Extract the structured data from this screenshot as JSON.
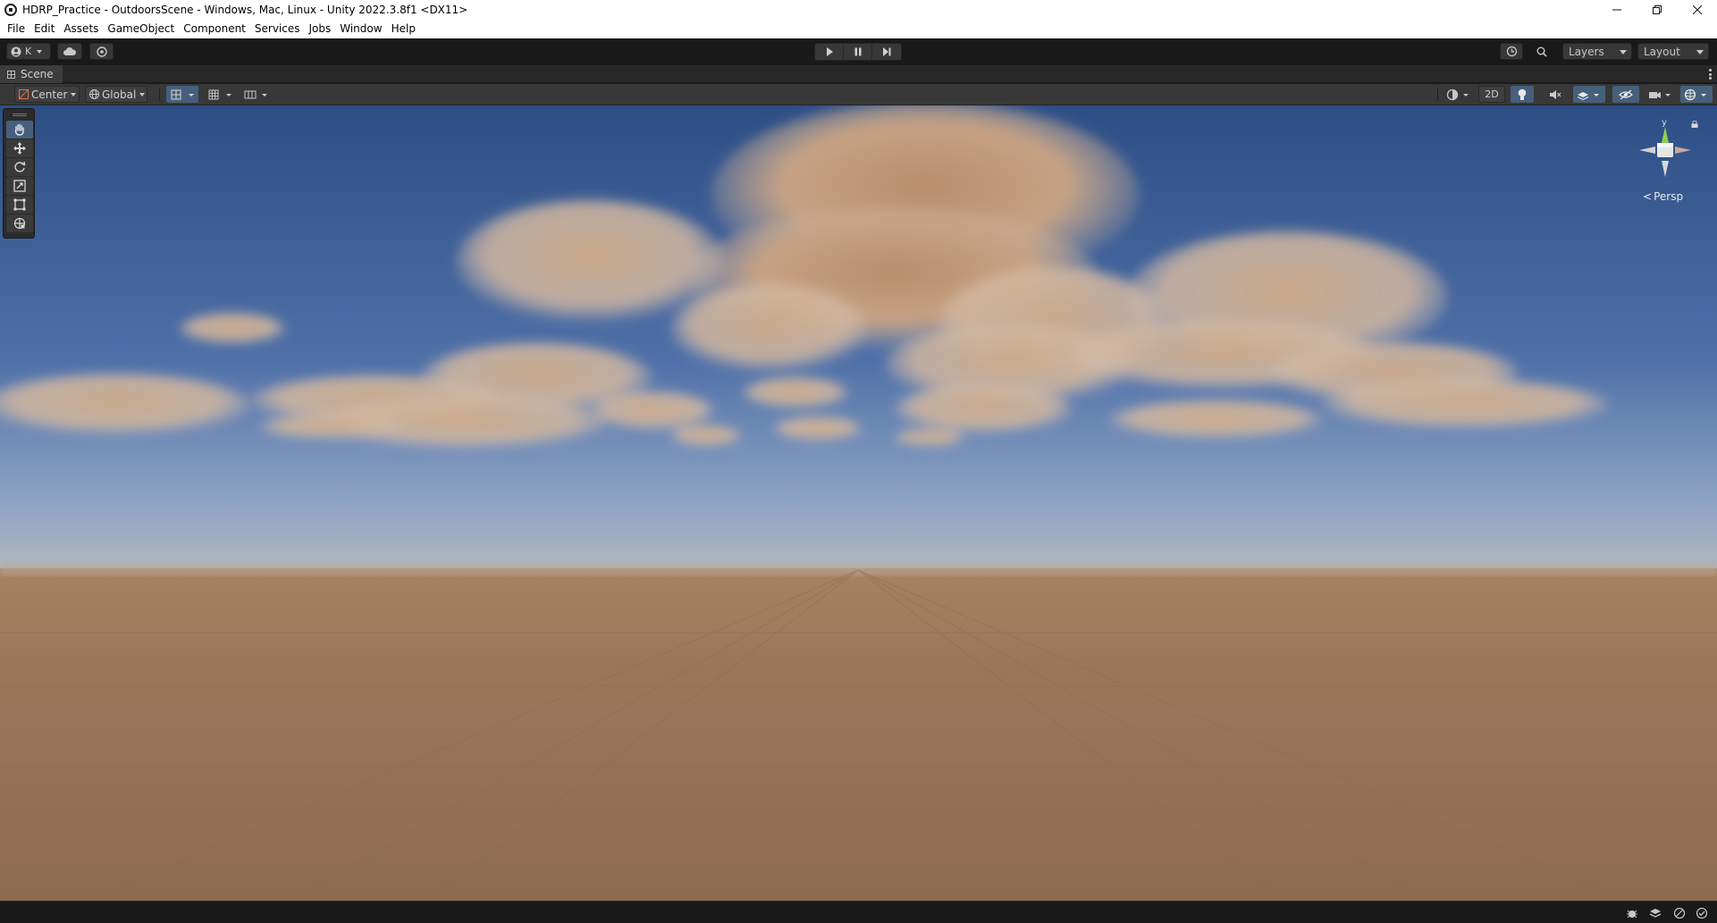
{
  "window": {
    "title": "HDRP_Practice - OutdoorsScene - Windows, Mac, Linux - Unity 2022.3.8f1 <DX11>",
    "controls": [
      "minimize-icon",
      "restore-icon",
      "close-icon"
    ]
  },
  "menu": {
    "items": [
      "File",
      "Edit",
      "Assets",
      "GameObject",
      "Component",
      "Services",
      "Jobs",
      "Window",
      "Help"
    ]
  },
  "toolbar": {
    "account_label": "K",
    "cloud_icon": "cloud-icon",
    "collab_icon": "collab-icon",
    "play_controls": [
      "play-icon",
      "pause-icon",
      "step-icon"
    ],
    "history_icon": "undo-history-icon",
    "search_icon": "search-icon",
    "layers_label": "Layers",
    "layout_label": "Layout"
  },
  "scene_tab": {
    "label": "Scene"
  },
  "scene_toolbar": {
    "pivot_mode": "Center",
    "pivot_rotation": "Global",
    "mode_2d_label": "2D"
  },
  "tools": [
    "hand-tool",
    "move-tool",
    "rotate-tool",
    "scale-tool",
    "rect-tool",
    "transform-tool"
  ],
  "gizmo": {
    "axis_label": "y",
    "projection_label": "Persp"
  },
  "colors": {
    "sky_top": "#2d4e85",
    "sky_mid": "#5c7fb3",
    "horizon": "#b0b6bf",
    "ground_near": "#8e6c4e",
    "ground_far": "#a47f60",
    "cloud": "#c8a382",
    "accent_active": "#46607c"
  }
}
